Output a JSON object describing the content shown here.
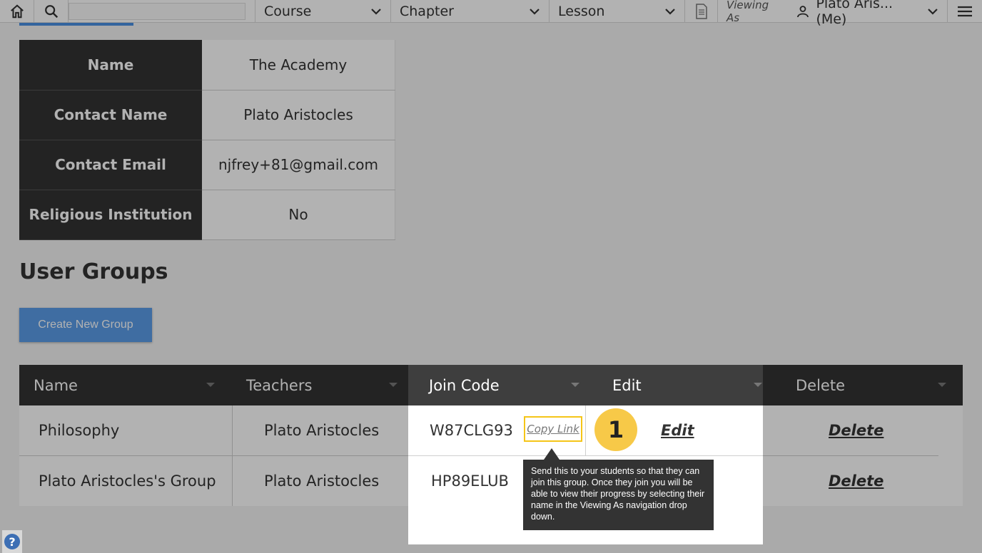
{
  "nav": {
    "search_placeholder": "",
    "course": "Course",
    "chapter": "Chapter",
    "lesson": "Lesson",
    "viewing_as": "Viewing As",
    "user": "Plato Aris... (Me)"
  },
  "org": {
    "rows": [
      {
        "label": "Name",
        "value": "The Academy"
      },
      {
        "label": "Contact Name",
        "value": "Plato Aristocles"
      },
      {
        "label": "Contact Email",
        "value": "njfrey+81@gmail.com"
      },
      {
        "label": "Religious Institution",
        "value": "No"
      }
    ]
  },
  "groups": {
    "title": "User Groups",
    "create_label": "Create New Group",
    "columns": {
      "name": "Name",
      "teachers": "Teachers",
      "join_code": "Join Code",
      "edit": "Edit",
      "delete": "Delete"
    },
    "rows": [
      {
        "name": "Philosophy",
        "teachers": "Plato Aristocles",
        "code": "W87CLG93",
        "copy": "Copy Link",
        "edit": "Edit",
        "delete": "Delete"
      },
      {
        "name": "Plato Aristocles's Group",
        "teachers": "Plato Aristocles",
        "code": "HP89ELUB",
        "delete": "Delete"
      }
    ]
  },
  "tour": {
    "step": "1",
    "tooltip": "Send this to your students so that they can join this group. Once they join you will be able to view their progress by selecting their name in the Viewing As navigation drop down.",
    "accent": "#f7c948"
  },
  "help_label": "?"
}
